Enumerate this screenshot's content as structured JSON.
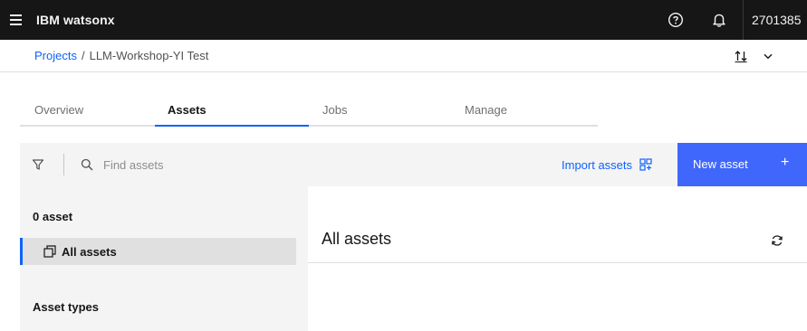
{
  "header": {
    "brand": "IBM watsonx",
    "account": "2701385"
  },
  "breadcrumb": {
    "projects_label": "Projects",
    "separator": "/",
    "current": "LLM-Workshop-YI Test"
  },
  "tabs": [
    {
      "label": "Overview",
      "active": false
    },
    {
      "label": "Assets",
      "active": true
    },
    {
      "label": "Jobs",
      "active": false
    },
    {
      "label": "Manage",
      "active": false
    }
  ],
  "toolbar": {
    "search_placeholder": "Find assets",
    "import_label": "Import assets",
    "new_asset_label": "New asset",
    "new_asset_plus": "+"
  },
  "sidebar": {
    "count_label": "0 asset",
    "all_assets_label": "All assets",
    "asset_types_label": "Asset types"
  },
  "main": {
    "title": "All assets"
  },
  "colors": {
    "shell_bg": "#161616",
    "accent": "#0f62fe",
    "primary_button": "#4067fc",
    "panel_bg": "#f4f4f4"
  },
  "icons": [
    "hamburger-menu-icon",
    "help-icon",
    "notification-bell-icon",
    "sort-icon",
    "chevron-down-icon",
    "filter-icon",
    "search-icon",
    "import-icon",
    "add-icon",
    "asset-group-icon",
    "refresh-icon"
  ]
}
